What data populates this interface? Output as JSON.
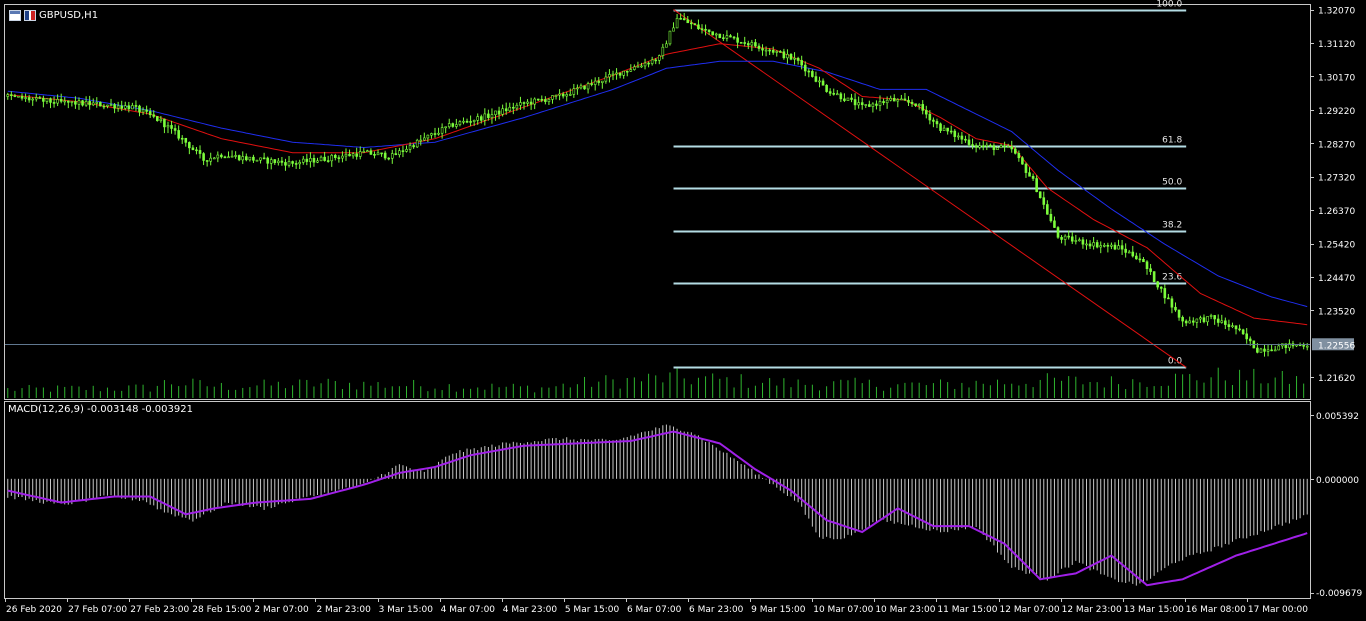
{
  "window": {
    "symbol_title": "GBPUSD,H1",
    "indicator_label": "MACD(12,26,9) -0.003148 -0.003921"
  },
  "colors": {
    "background": "#000000",
    "frame": "#c8c8c8",
    "bull": "#7CFC3C",
    "bear": "#7CFC3C",
    "fib": "#b4dce4",
    "ma_fast": "#e01010",
    "ma_slow": "#1f2ef0",
    "trend": "#e01010",
    "volume": "#2fb52f",
    "macd_hist": "#c8c8c8",
    "macd_signal": "#a020e8",
    "price_line": "#607890"
  },
  "chart_data": [
    {
      "type": "candlestick",
      "title": "GBPUSD,H1",
      "y_ticks": [
        "1.32070",
        "1.31120",
        "1.30170",
        "1.29220",
        "1.28270",
        "1.27320",
        "1.26370",
        "1.25420",
        "1.24470",
        "1.23520",
        "1.22556",
        "1.21620"
      ],
      "y_tick_values": [
        1.3207,
        1.3112,
        1.3017,
        1.2922,
        1.2827,
        1.2732,
        1.2637,
        1.2542,
        1.2447,
        1.2352,
        1.22556,
        1.2162
      ],
      "ylim": [
        1.21,
        1.322
      ],
      "current_price": "1.22556",
      "x_ticks": [
        "26 Feb 2020",
        "27 Feb 07:00",
        "27 Feb 23:00",
        "28 Feb 15:00",
        "2 Mar 07:00",
        "2 Mar 23:00",
        "3 Mar 15:00",
        "4 Mar 07:00",
        "4 Mar 23:00",
        "5 Mar 15:00",
        "6 Mar 07:00",
        "6 Mar 23:00",
        "9 Mar 15:00",
        "10 Mar 07:00",
        "10 Mar 23:00",
        "11 Mar 15:00",
        "12 Mar 07:00",
        "12 Mar 23:00",
        "13 Mar 15:00",
        "16 Mar 08:00",
        "17 Mar 00:00"
      ],
      "close_path": [
        [
          0,
          1.296
        ],
        [
          12,
          1.2945
        ],
        [
          25,
          1.2938
        ],
        [
          35,
          1.293
        ],
        [
          43,
          1.289
        ],
        [
          50,
          1.283
        ],
        [
          55,
          1.278
        ],
        [
          60,
          1.2795
        ],
        [
          70,
          1.278
        ],
        [
          80,
          1.277
        ],
        [
          90,
          1.2785
        ],
        [
          100,
          1.28
        ],
        [
          108,
          1.279
        ],
        [
          115,
          1.283
        ],
        [
          125,
          1.288
        ],
        [
          135,
          1.2905
        ],
        [
          145,
          1.294
        ],
        [
          155,
          1.296
        ],
        [
          165,
          1.3
        ],
        [
          175,
          1.304
        ],
        [
          183,
          1.307
        ],
        [
          188,
          1.3185
        ],
        [
          195,
          1.315
        ],
        [
          205,
          1.312
        ],
        [
          215,
          1.309
        ],
        [
          222,
          1.306
        ],
        [
          230,
          1.298
        ],
        [
          240,
          1.293
        ],
        [
          248,
          1.295
        ],
        [
          255,
          1.294
        ],
        [
          262,
          1.287
        ],
        [
          272,
          1.282
        ],
        [
          282,
          1.281
        ],
        [
          288,
          1.272
        ],
        [
          295,
          1.256
        ],
        [
          305,
          1.254
        ],
        [
          312,
          1.253
        ],
        [
          318,
          1.25
        ],
        [
          324,
          1.241
        ],
        [
          330,
          1.232
        ],
        [
          338,
          1.233
        ],
        [
          345,
          1.23
        ],
        [
          351,
          1.224
        ],
        [
          358,
          1.225
        ],
        [
          366,
          1.2256
        ]
      ],
      "ma_fast_path": [
        [
          0,
          1.2965
        ],
        [
          20,
          1.2945
        ],
        [
          40,
          1.291
        ],
        [
          60,
          1.284
        ],
        [
          80,
          1.28
        ],
        [
          100,
          1.28
        ],
        [
          120,
          1.284
        ],
        [
          145,
          1.293
        ],
        [
          170,
          1.302
        ],
        [
          185,
          1.308
        ],
        [
          200,
          1.311
        ],
        [
          215,
          1.3095
        ],
        [
          228,
          1.304
        ],
        [
          240,
          1.296
        ],
        [
          252,
          1.295
        ],
        [
          262,
          1.29
        ],
        [
          272,
          1.284
        ],
        [
          282,
          1.282
        ],
        [
          292,
          1.27
        ],
        [
          305,
          1.261
        ],
        [
          320,
          1.253
        ],
        [
          335,
          1.24
        ],
        [
          350,
          1.233
        ],
        [
          366,
          1.231
        ]
      ],
      "ma_slow_path": [
        [
          0,
          1.2975
        ],
        [
          20,
          1.2955
        ],
        [
          40,
          1.292
        ],
        [
          60,
          1.287
        ],
        [
          80,
          1.283
        ],
        [
          100,
          1.2815
        ],
        [
          120,
          1.283
        ],
        [
          145,
          1.29
        ],
        [
          170,
          1.298
        ],
        [
          185,
          1.304
        ],
        [
          200,
          1.306
        ],
        [
          215,
          1.306
        ],
        [
          230,
          1.303
        ],
        [
          245,
          1.298
        ],
        [
          258,
          1.298
        ],
        [
          270,
          1.292
        ],
        [
          282,
          1.286
        ],
        [
          295,
          1.275
        ],
        [
          310,
          1.264
        ],
        [
          325,
          1.254
        ],
        [
          340,
          1.245
        ],
        [
          355,
          1.239
        ],
        [
          366,
          1.236
        ]
      ],
      "fibonacci": {
        "x_start": 187,
        "x_end": 331,
        "high": 1.3207,
        "low": 1.219,
        "levels": [
          {
            "label": "100.0",
            "ratio": 1.0
          },
          {
            "label": "61.8",
            "ratio": 0.618
          },
          {
            "label": "50.0",
            "ratio": 0.5
          },
          {
            "label": "38.2",
            "ratio": 0.382
          },
          {
            "label": "23.6",
            "ratio": 0.236
          },
          {
            "label": "0.0",
            "ratio": 0.0
          }
        ]
      },
      "trendline": {
        "from": [
          187,
          1.3207
        ],
        "to": [
          331,
          1.219
        ]
      },
      "volume_profile": [
        [
          0,
          0.3
        ],
        [
          40,
          0.35
        ],
        [
          45,
          0.55
        ],
        [
          60,
          0.4
        ],
        [
          90,
          0.5
        ],
        [
          110,
          0.45
        ],
        [
          150,
          0.35
        ],
        [
          165,
          0.55
        ],
        [
          187,
          0.7
        ],
        [
          220,
          0.5
        ],
        [
          260,
          0.45
        ],
        [
          290,
          0.6
        ],
        [
          310,
          0.55
        ],
        [
          340,
          0.75
        ],
        [
          366,
          0.6
        ]
      ]
    },
    {
      "type": "histogram",
      "title": "MACD(12,26,9) -0.003148 -0.003921",
      "y_ticks": [
        "0.005392",
        "0.000000",
        "-0.009679"
      ],
      "y_tick_values": [
        0.005392,
        0.0,
        -0.009679
      ],
      "ylim": [
        -0.01,
        0.0065
      ],
      "main_value": -0.003148,
      "signal_value": -0.003921,
      "hist_path": [
        [
          0,
          -0.0015
        ],
        [
          15,
          -0.0022
        ],
        [
          28,
          -0.0015
        ],
        [
          38,
          -0.0018
        ],
        [
          44,
          -0.0028
        ],
        [
          52,
          -0.0035
        ],
        [
          62,
          -0.002
        ],
        [
          72,
          -0.0025
        ],
        [
          85,
          -0.0015
        ],
        [
          100,
          -0.0005
        ],
        [
          110,
          0.0012
        ],
        [
          117,
          0.0005
        ],
        [
          125,
          0.0022
        ],
        [
          140,
          0.003
        ],
        [
          155,
          0.0034
        ],
        [
          170,
          0.0032
        ],
        [
          185,
          0.0045
        ],
        [
          192,
          0.004
        ],
        [
          205,
          0.0015
        ],
        [
          215,
          -0.0005
        ],
        [
          222,
          -0.002
        ],
        [
          228,
          -0.005
        ],
        [
          235,
          -0.005
        ],
        [
          245,
          -0.0035
        ],
        [
          255,
          -0.004
        ],
        [
          262,
          -0.0045
        ],
        [
          272,
          -0.004
        ],
        [
          282,
          -0.0075
        ],
        [
          292,
          -0.0085
        ],
        [
          300,
          -0.007
        ],
        [
          310,
          -0.0085
        ],
        [
          318,
          -0.009
        ],
        [
          328,
          -0.007
        ],
        [
          338,
          -0.006
        ],
        [
          352,
          -0.0045
        ],
        [
          366,
          -0.003
        ]
      ],
      "signal_path": [
        [
          0,
          -0.001
        ],
        [
          15,
          -0.002
        ],
        [
          30,
          -0.0015
        ],
        [
          40,
          -0.0015
        ],
        [
          50,
          -0.003
        ],
        [
          58,
          -0.0025
        ],
        [
          70,
          -0.002
        ],
        [
          85,
          -0.0017
        ],
        [
          100,
          -0.0005
        ],
        [
          110,
          0.0005
        ],
        [
          120,
          0.001
        ],
        [
          130,
          0.002
        ],
        [
          145,
          0.0028
        ],
        [
          160,
          0.003
        ],
        [
          175,
          0.0032
        ],
        [
          187,
          0.004
        ],
        [
          200,
          0.003
        ],
        [
          210,
          0.0008
        ],
        [
          220,
          -0.001
        ],
        [
          230,
          -0.0035
        ],
        [
          240,
          -0.0045
        ],
        [
          250,
          -0.0025
        ],
        [
          260,
          -0.004
        ],
        [
          270,
          -0.004
        ],
        [
          280,
          -0.0055
        ],
        [
          290,
          -0.0085
        ],
        [
          300,
          -0.008
        ],
        [
          310,
          -0.0065
        ],
        [
          320,
          -0.009
        ],
        [
          330,
          -0.0085
        ],
        [
          345,
          -0.0065
        ],
        [
          366,
          -0.0045
        ]
      ]
    }
  ]
}
